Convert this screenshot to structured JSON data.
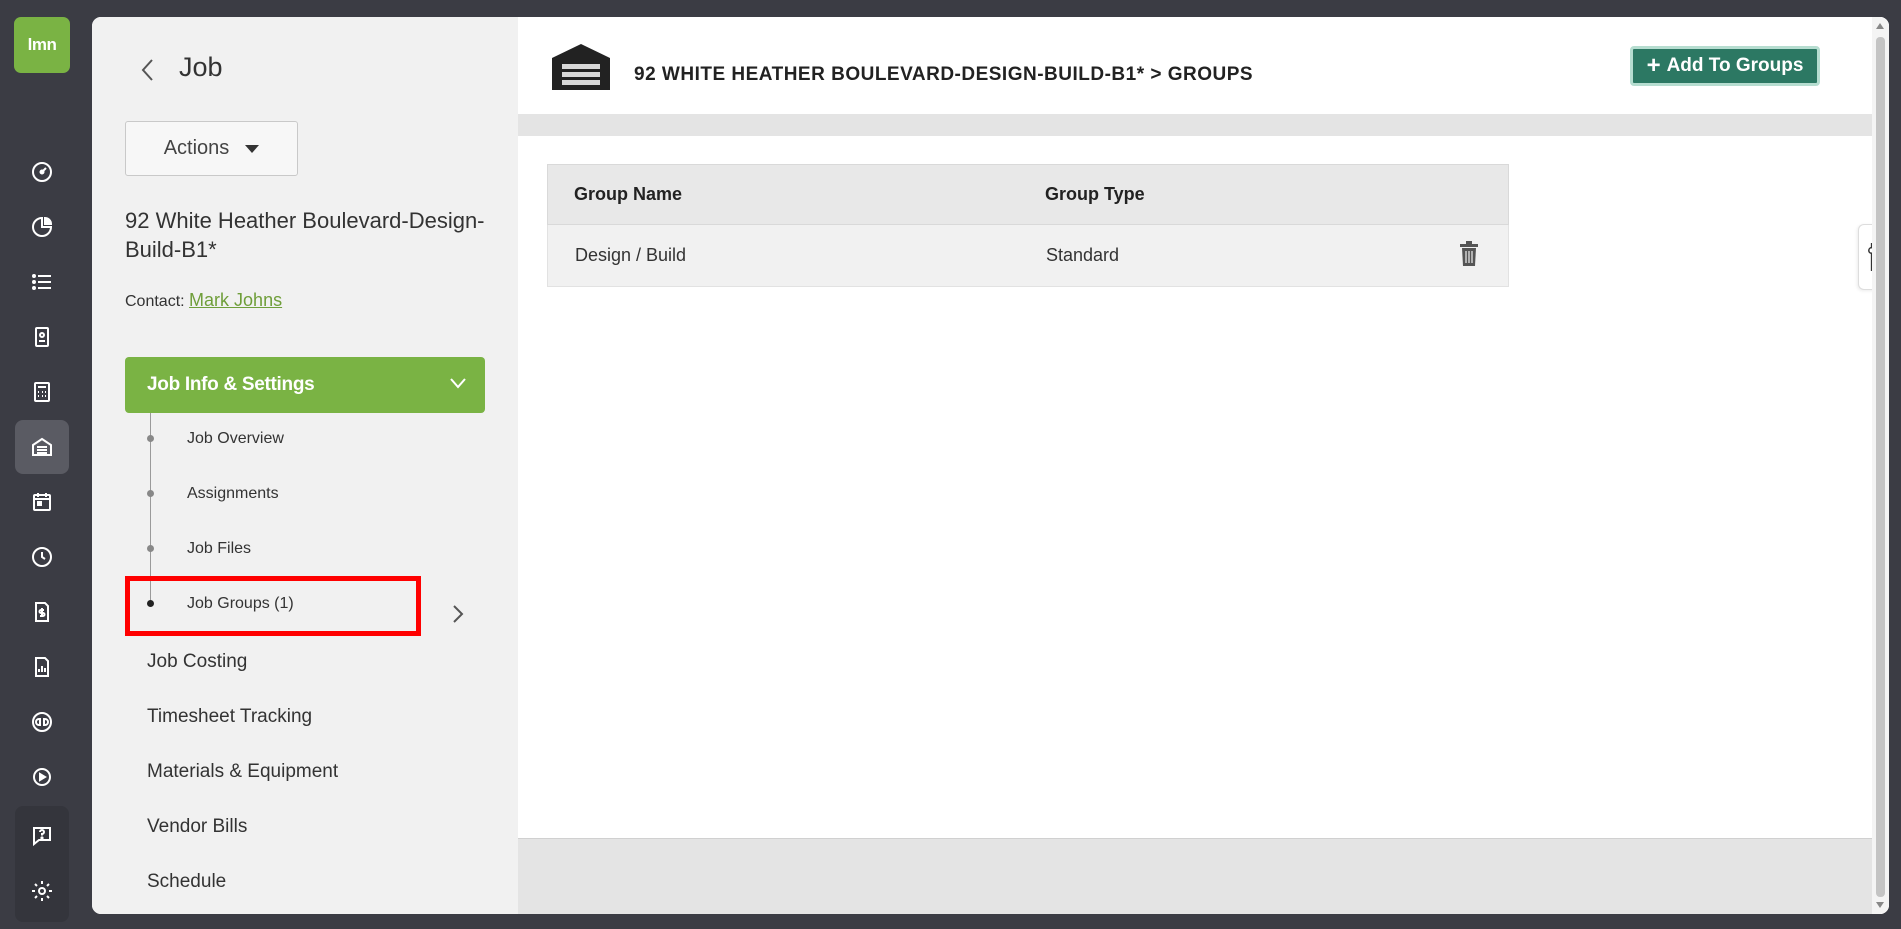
{
  "app": {
    "logo_text": "lmn",
    "brand_color": "#7ab344",
    "accent_color": "#2c7863",
    "highlight_color": "#ff0000"
  },
  "rail": {
    "items": [
      {
        "icon": "dashboard-gauge-icon"
      },
      {
        "icon": "pie-chart-icon"
      },
      {
        "icon": "list-icon"
      },
      {
        "icon": "contact-card-icon"
      },
      {
        "icon": "calculator-icon"
      },
      {
        "icon": "jobs-building-icon",
        "active": true
      },
      {
        "icon": "calendar-icon"
      },
      {
        "icon": "clock-icon"
      },
      {
        "icon": "invoice-dollar-icon"
      },
      {
        "icon": "report-chart-icon"
      },
      {
        "icon": "quickbooks-icon"
      },
      {
        "icon": "play-circle-icon"
      }
    ],
    "bottom": [
      {
        "icon": "help-icon"
      },
      {
        "icon": "settings-gear-icon"
      }
    ]
  },
  "side": {
    "title": "Job",
    "actions_label": "Actions",
    "job_name": "92 White Heather Boulevard-Design-Build-B1*",
    "contact_label": "Contact:",
    "contact_name": "Mark Johns",
    "section_label": "Job Info & Settings",
    "sub_items": [
      "Job Overview",
      "Assignments",
      "Job Files",
      "Job Groups (1)"
    ],
    "nav_items": [
      "Job Costing",
      "Timesheet Tracking",
      "Materials & Equipment",
      "Vendor Bills",
      "Schedule"
    ]
  },
  "content": {
    "breadcrumb": "92 WHITE HEATHER BOULEVARD-DESIGN-BUILD-B1* > GROUPS",
    "add_button": "Add To Groups",
    "add_button_icon": "+",
    "table": {
      "headers": [
        "Group Name",
        "Group Type"
      ],
      "rows": [
        {
          "name": "Design / Build",
          "type": "Standard"
        }
      ]
    }
  }
}
